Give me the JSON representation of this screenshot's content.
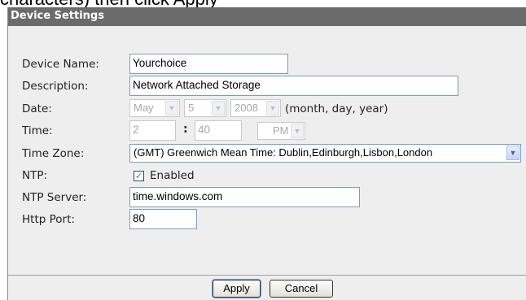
{
  "caption": "characters) then click Apply",
  "panel": {
    "title": "Device Settings"
  },
  "fields": {
    "device_name": {
      "label": "Device Name:",
      "value": "Yourchoice"
    },
    "description": {
      "label": "Description:",
      "value": "Network Attached Storage"
    },
    "date": {
      "label": "Date:",
      "month": "May",
      "day": "5",
      "year": "2008",
      "hint": "(month, day, year)"
    },
    "time": {
      "label": "Time:",
      "hour": "2",
      "separator": ":",
      "minute": "40",
      "ampm": "PM"
    },
    "time_zone": {
      "label": "Time Zone:",
      "value": "(GMT) Greenwich Mean Time: Dublin,Edinburgh,Lisbon,London"
    },
    "ntp": {
      "label": "NTP:",
      "checkbox_label": "Enabled",
      "checked": true
    },
    "ntp_server": {
      "label": "NTP Server:",
      "value": "time.windows.com"
    },
    "http_port": {
      "label": "Http Port:",
      "value": "80"
    }
  },
  "buttons": {
    "apply": "Apply",
    "cancel": "Cancel"
  },
  "icons": {
    "dropdown_arrow": "chevron-down-icon",
    "checkmark": "check-icon"
  },
  "colors": {
    "title_bar": "#6b6b6b",
    "panel_bg": "#eeeeee",
    "input_border": "#7f9db9",
    "check_green": "#21a121"
  }
}
